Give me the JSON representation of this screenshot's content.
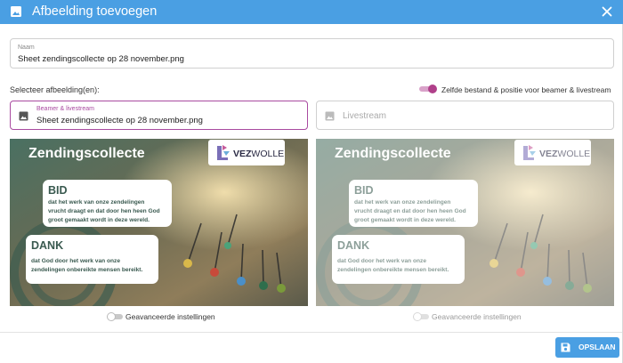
{
  "dialog": {
    "title": "Afbeelding toevoegen",
    "title_icon": "image-icon",
    "close_icon": "close-icon",
    "header_color": "#4a9fe3"
  },
  "naam": {
    "label": "Naam",
    "value": "Sheet zendingscollecte op 28 november.png"
  },
  "select": {
    "label": "Selecteer afbeelding(en):",
    "same_toggle_label": "Zelfde bestand & positie voor beamer & livestream",
    "same_toggle_on": true,
    "accent_color": "#a94aa0"
  },
  "beamer": {
    "label": "Beamer & livestream",
    "value": "Sheet zendingscollecte op 28 november.png",
    "icon": "image-icon"
  },
  "livestream": {
    "placeholder": "Livestream",
    "icon": "image-icon"
  },
  "slide": {
    "title": "Zendingscollecte",
    "logo_text_bold": "VEZ",
    "logo_text_light": "WOLLE",
    "bid_title": "BID",
    "bid_lines": [
      "dat het werk van onze zendelingen",
      "vrucht draagt en dat door hen heen God",
      "groot gemaakt wordt in deze wereld."
    ],
    "dank_title": "DANK",
    "dank_lines": [
      "dat God door het werk van onze",
      "zendelingen onbereikte mensen bereikt."
    ]
  },
  "advanced": {
    "left_label": "Geavanceerde instellingen",
    "right_label": "Geavanceerde instellingen",
    "left_on": false,
    "right_on": false
  },
  "footer": {
    "save_label": "OPSLAAN",
    "save_icon": "floppy-disk-icon",
    "save_color": "#4a9fe3"
  }
}
